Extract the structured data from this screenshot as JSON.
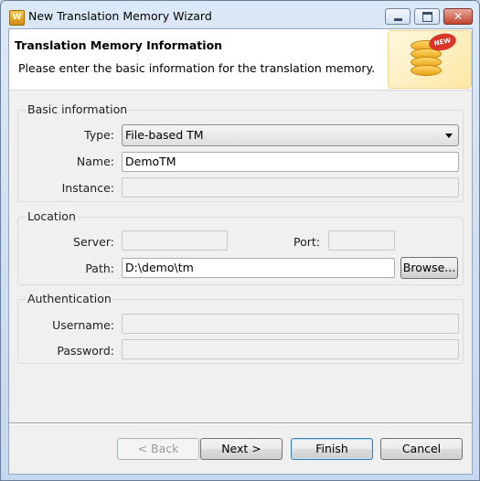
{
  "window": {
    "title": "New Translation Memory Wizard",
    "app_icon_glyph": "W",
    "controls": {
      "minimize": "minimize-icon",
      "maximize": "maximize-icon",
      "close_glyph": "✕"
    }
  },
  "header": {
    "title": "Translation Memory Information",
    "description": "Please enter the basic information for the translation memory.",
    "image_badge": "NEW"
  },
  "basic": {
    "group_label": "Basic information",
    "type_label": "Type:",
    "type_value": "File-based TM",
    "name_label": "Name:",
    "name_value": "DemoTM",
    "instance_label": "Instance:",
    "instance_value": ""
  },
  "location": {
    "group_label": "Location",
    "server_label": "Server:",
    "server_value": "",
    "port_label": "Port:",
    "port_value": "",
    "path_label": "Path:",
    "path_value": "D:\\demo\\tm",
    "browse_label": "Browse..."
  },
  "auth": {
    "group_label": "Authentication",
    "username_label": "Username:",
    "username_value": "",
    "password_label": "Password:",
    "password_value": ""
  },
  "buttons": {
    "back": "< Back",
    "next": "Next >",
    "finish": "Finish",
    "cancel": "Cancel"
  }
}
